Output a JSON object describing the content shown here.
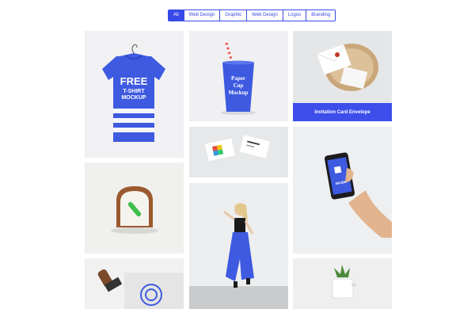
{
  "filters": [
    {
      "label": "All",
      "active": true
    },
    {
      "label": "Web Design",
      "active": false
    },
    {
      "label": "Graphic",
      "active": false
    },
    {
      "label": "Web Design",
      "active": false
    },
    {
      "label": "Logos",
      "active": false
    },
    {
      "label": "Branding",
      "active": false
    }
  ],
  "tiles": {
    "tshirt": {
      "headline": "FREE",
      "line2": "T-SHIRT",
      "line3": "MOCKUP"
    },
    "cup": {
      "line1": "Paper",
      "line2": "Cup",
      "line3": "Mockup"
    },
    "envelope": {
      "caption": "Invitation Card Envelope"
    },
    "phone": {
      "app_name": "SKUBE"
    }
  },
  "colors": {
    "accent": "#3949e8",
    "product_blue": "#3e5ae0"
  }
}
